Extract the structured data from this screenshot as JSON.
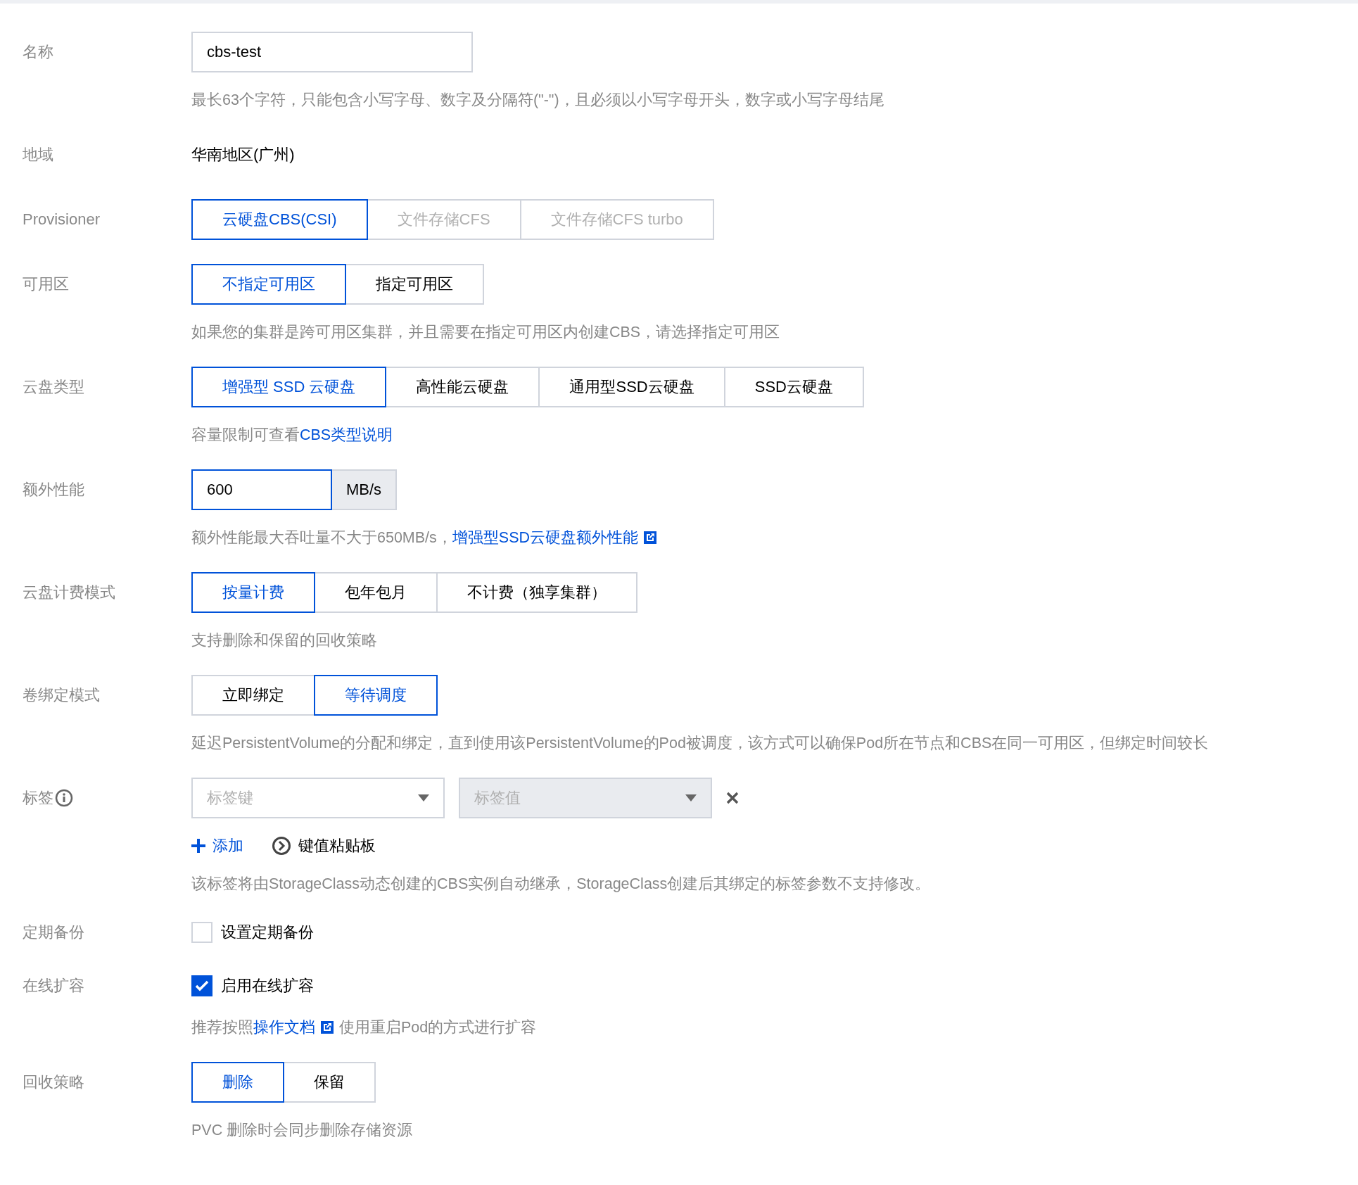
{
  "rows": [
    {
      "kind": "input",
      "label": "名称",
      "value": "cbs-test",
      "focused": false,
      "hint": [
        {
          "kind": "text",
          "text": "最长63个字符，只能包含小写字母、数字及分隔符(\"-\")，且必须以小写字母开头，数字或小写字母结尾"
        }
      ]
    },
    {
      "kind": "text",
      "label": "地域",
      "value": "华南地区(广州)"
    },
    {
      "kind": "segmented",
      "label": "Provisioner",
      "options": [
        {
          "label": "云硬盘CBS(CSI)",
          "selected": true,
          "disabled": false
        },
        {
          "label": "文件存储CFS",
          "selected": false,
          "disabled": true
        },
        {
          "label": "文件存储CFS turbo",
          "selected": false,
          "disabled": true
        }
      ]
    },
    {
      "kind": "segmented",
      "label": "可用区",
      "options": [
        {
          "label": "不指定可用区",
          "selected": true,
          "disabled": false
        },
        {
          "label": "指定可用区",
          "selected": false,
          "disabled": false
        }
      ],
      "hint": [
        {
          "kind": "text",
          "text": "如果您的集群是跨可用区集群，并且需要在指定可用区内创建CBS，请选择指定可用区"
        }
      ]
    },
    {
      "kind": "segmented",
      "label": "云盘类型",
      "options": [
        {
          "label": "增强型 SSD 云硬盘",
          "selected": true,
          "disabled": false
        },
        {
          "label": "高性能云硬盘",
          "selected": false,
          "disabled": false
        },
        {
          "label": "通用型SSD云硬盘",
          "selected": false,
          "disabled": false
        },
        {
          "label": "SSD云硬盘",
          "selected": false,
          "disabled": false
        }
      ],
      "hint": [
        {
          "kind": "text",
          "text": "容量限制可查看"
        },
        {
          "kind": "link",
          "text": "CBS类型说明",
          "external": false
        }
      ]
    },
    {
      "kind": "input",
      "label": "额外性能",
      "value": "600",
      "unit": "MB/s",
      "focused": true,
      "hint": [
        {
          "kind": "text",
          "text": "额外性能最大吞吐量不大于650MB/s，"
        },
        {
          "kind": "link",
          "text": "增强型SSD云硬盘额外性能",
          "external": true
        }
      ]
    },
    {
      "kind": "segmented",
      "label": "云盘计费模式",
      "options": [
        {
          "label": "按量计费",
          "selected": true,
          "disabled": false
        },
        {
          "label": "包年包月",
          "selected": false,
          "disabled": false
        },
        {
          "label": "不计费（独享集群）",
          "selected": false,
          "disabled": false
        }
      ],
      "hint": [
        {
          "kind": "text",
          "text": "支持删除和保留的回收策略"
        }
      ]
    },
    {
      "kind": "segmented",
      "label": "卷绑定模式",
      "options": [
        {
          "label": "立即绑定",
          "selected": false,
          "disabled": false
        },
        {
          "label": "等待调度",
          "selected": true,
          "disabled": false
        }
      ],
      "hint": [
        {
          "kind": "text",
          "text": "延迟PersistentVolume的分配和绑定，直到使用该PersistentVolume的Pod被调度，该方式可以确保Pod所在节点和CBS在同一可用区，但绑定时间较长"
        }
      ]
    },
    {
      "kind": "tags",
      "label": "标签",
      "info": true,
      "key_select": {
        "placeholder": "标签键",
        "disabled": false
      },
      "value_select": {
        "placeholder": "标签值",
        "disabled": true
      },
      "actions": [
        {
          "kind": "add",
          "label": "添加"
        },
        {
          "kind": "paste",
          "label": "键值粘贴板"
        }
      ],
      "hint": [
        {
          "kind": "text",
          "text": "该标签将由StorageClass动态创建的CBS实例自动继承，StorageClass创建后其绑定的标签参数不支持修改。"
        }
      ]
    },
    {
      "kind": "checkbox",
      "label": "定期备份",
      "option": "设置定期备份",
      "checked": false
    },
    {
      "kind": "checkbox",
      "label": "在线扩容",
      "option": "启用在线扩容",
      "checked": true,
      "hint": [
        {
          "kind": "text",
          "text": "推荐按照"
        },
        {
          "kind": "link",
          "text": "操作文档",
          "external": true
        },
        {
          "kind": "text",
          "text": "使用重启Pod的方式进行扩容"
        }
      ]
    },
    {
      "kind": "segmented",
      "label": "回收策略",
      "options": [
        {
          "label": "删除",
          "selected": true,
          "disabled": false
        },
        {
          "label": "保留",
          "selected": false,
          "disabled": false
        }
      ],
      "hint": [
        {
          "kind": "text",
          "text": "PVC 删除时会同步删除存储资源"
        }
      ]
    }
  ]
}
